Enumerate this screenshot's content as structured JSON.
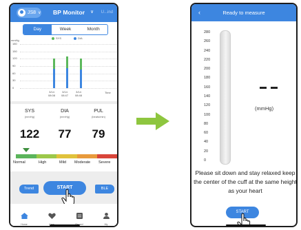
{
  "left_screen": {
    "header": {
      "user_label": "JS8",
      "title": "BP Monitor",
      "right_text": "U...ind"
    },
    "tabs": [
      {
        "label": "Day",
        "active": true
      },
      {
        "label": "Week",
        "active": false
      },
      {
        "label": "Month",
        "active": false
      }
    ],
    "chart_data": {
      "type": "bar",
      "ylabel": "mmHg",
      "xlabel": "Time",
      "y_ticks": [
        "180",
        "150",
        "120",
        "90",
        "60",
        "30",
        "0"
      ],
      "ylim": [
        0,
        180
      ],
      "categories": [
        "3/14 08:08",
        "3/14 08:47",
        "3/14 08:48"
      ],
      "x_tick_lines": [
        [
          "3/14",
          "08:08"
        ],
        [
          "3/14",
          "08:47"
        ],
        [
          "3/14",
          "08:48"
        ]
      ],
      "series": [
        {
          "name": "SYS",
          "color": "#5cb85c",
          "values": [
            120,
            128,
            122
          ]
        },
        {
          "name": "DIA",
          "color": "#3d86e0",
          "values": [
            78,
            82,
            77
          ]
        }
      ],
      "grid": true,
      "legend": "top"
    },
    "readings": [
      {
        "label": "SYS",
        "unit": "(mmHg)",
        "value": "122"
      },
      {
        "label": "DIA",
        "unit": "(mmHg)",
        "value": "77"
      },
      {
        "label": "PUL",
        "unit": "(beats/min)",
        "value": "79"
      }
    ],
    "scale": {
      "labels": [
        "Normal",
        "High",
        "Mild",
        "Moderate",
        "Severe"
      ],
      "colors": [
        "#5bb55b",
        "#9cc84a",
        "#e0c23c",
        "#e89a3c",
        "#d9453a"
      ],
      "indicator_color": "#3d8f3d"
    },
    "buttons": {
      "trend": "Trend",
      "start": "START",
      "ble": "BLE"
    },
    "tabbar": [
      {
        "label": "Home",
        "icon": "home-icon"
      },
      {
        "label": "Care",
        "icon": "heart-icon"
      },
      {
        "label": "Record",
        "icon": "record-icon"
      },
      {
        "label": "My",
        "icon": "person-icon"
      }
    ],
    "accent": "#3d86e0"
  },
  "arrow_color": "#8ec63f",
  "right_screen": {
    "header": {
      "title": "Ready to measure",
      "back_icon": "back-chevron-icon"
    },
    "gauge_ticks": [
      "280",
      "260",
      "240",
      "220",
      "200",
      "180",
      "160",
      "140",
      "120",
      "100",
      "80",
      "60",
      "40",
      "20",
      "0"
    ],
    "reading_placeholder": "--",
    "unit": "(mmHg)",
    "instruction": "Please sit down and stay relaxed keep the center of the cuff at the same height as your heart",
    "start_label": "START"
  }
}
